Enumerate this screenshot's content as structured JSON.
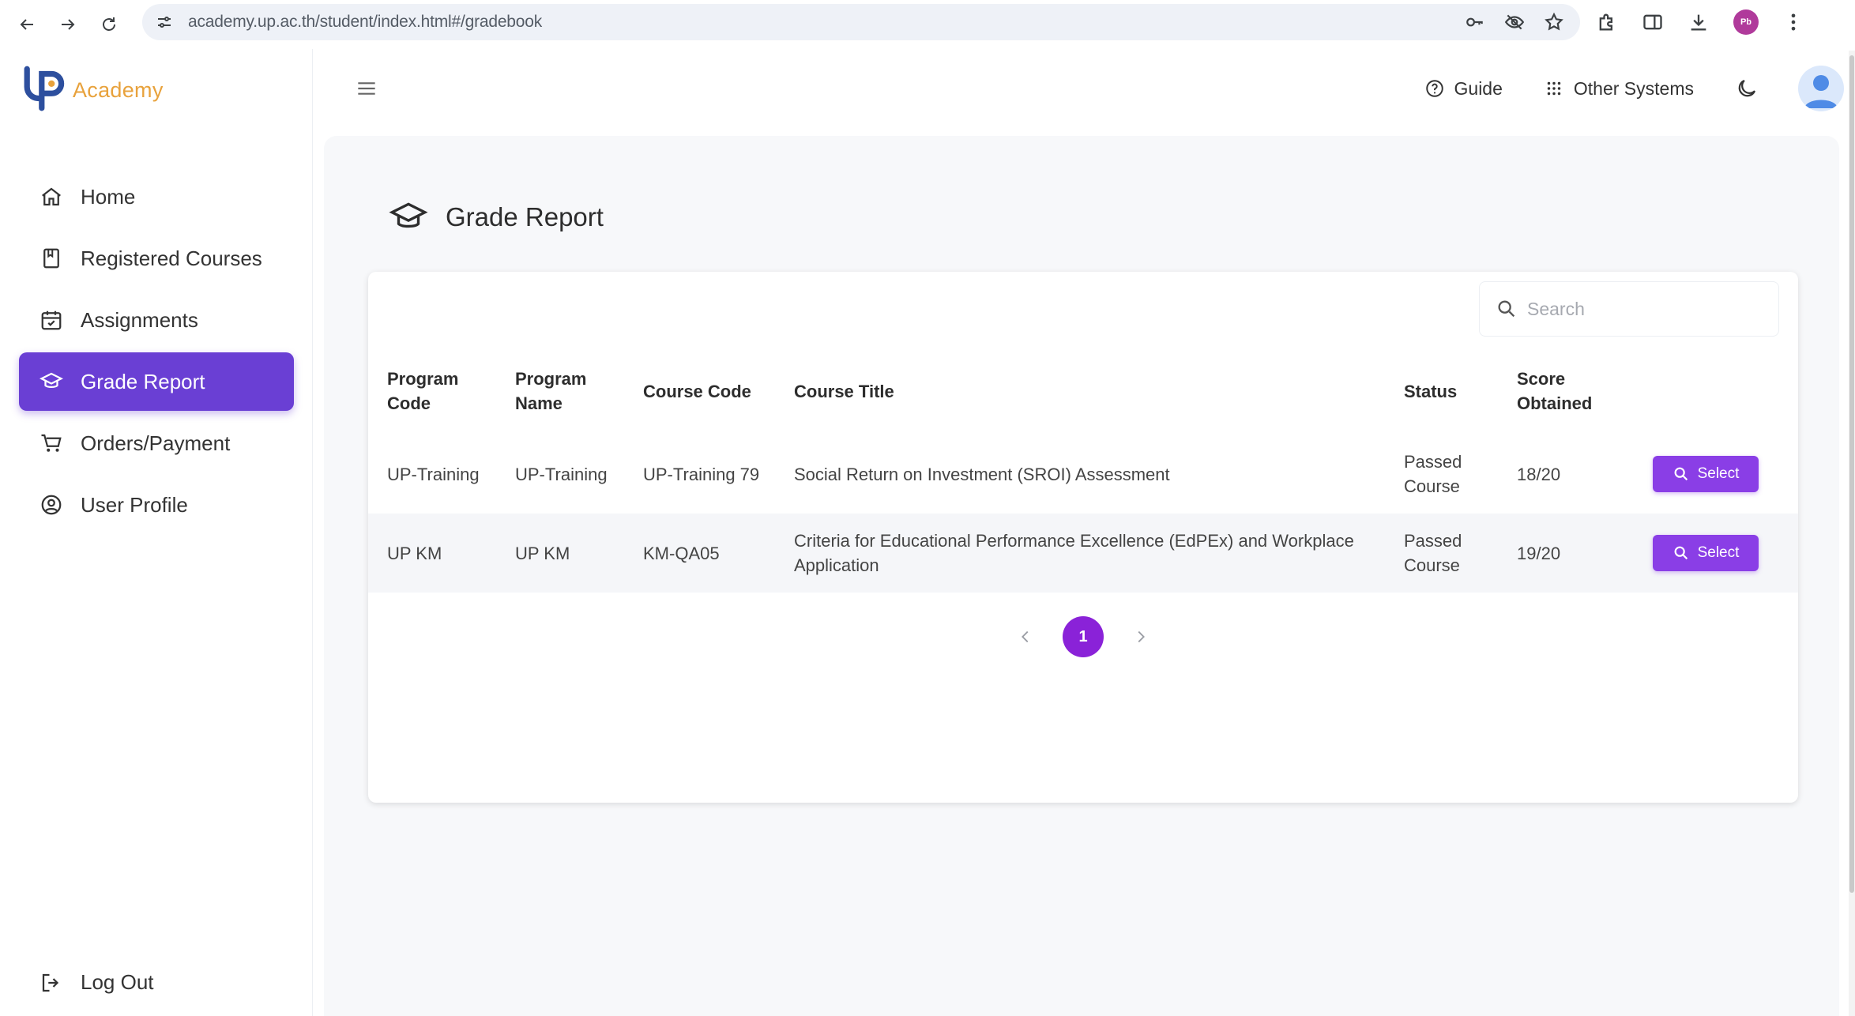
{
  "browser": {
    "url": "academy.up.ac.th/student/index.html#/gradebook",
    "profile_initials": "Pb"
  },
  "sidebar": {
    "logo_text": "Academy",
    "items": [
      {
        "label": "Home",
        "icon": "home-icon"
      },
      {
        "label": "Registered Courses",
        "icon": "book-icon"
      },
      {
        "label": "Assignments",
        "icon": "calendar-check-icon"
      },
      {
        "label": "Grade Report",
        "icon": "graduation-cap-icon",
        "active": true
      },
      {
        "label": "Orders/Payment",
        "icon": "cart-icon"
      },
      {
        "label": "User Profile",
        "icon": "user-circle-icon"
      }
    ],
    "logout_label": "Log Out"
  },
  "header": {
    "guide_label": "Guide",
    "other_systems_label": "Other Systems"
  },
  "page": {
    "title": "Grade Report",
    "search_placeholder": "Search",
    "columns": [
      "Program Code",
      "Program Name",
      "Course Code",
      "Course Title",
      "Status",
      "Score Obtained",
      ""
    ],
    "rows": [
      {
        "program_code": "UP-Training",
        "program_name": "UP-Training",
        "course_code": "UP-Training 79",
        "course_title": "Social Return on Investment (SROI) Assessment",
        "status": "Passed Course",
        "score": "18/20",
        "action": "Select"
      },
      {
        "program_code": "UP KM",
        "program_name": "UP KM",
        "course_code": "KM-QA05",
        "course_title": "Criteria for Educational Performance Excellence (EdPEx) and Workplace Application",
        "status": "Passed Course",
        "score": "19/20",
        "action": "Select"
      }
    ],
    "pagination": {
      "current": "1"
    }
  },
  "colors": {
    "accent": "#6a3fd4",
    "button": "#8a3ee6",
    "logo_orange": "#e8a23c",
    "logo_blue": "#2d4f9e"
  }
}
